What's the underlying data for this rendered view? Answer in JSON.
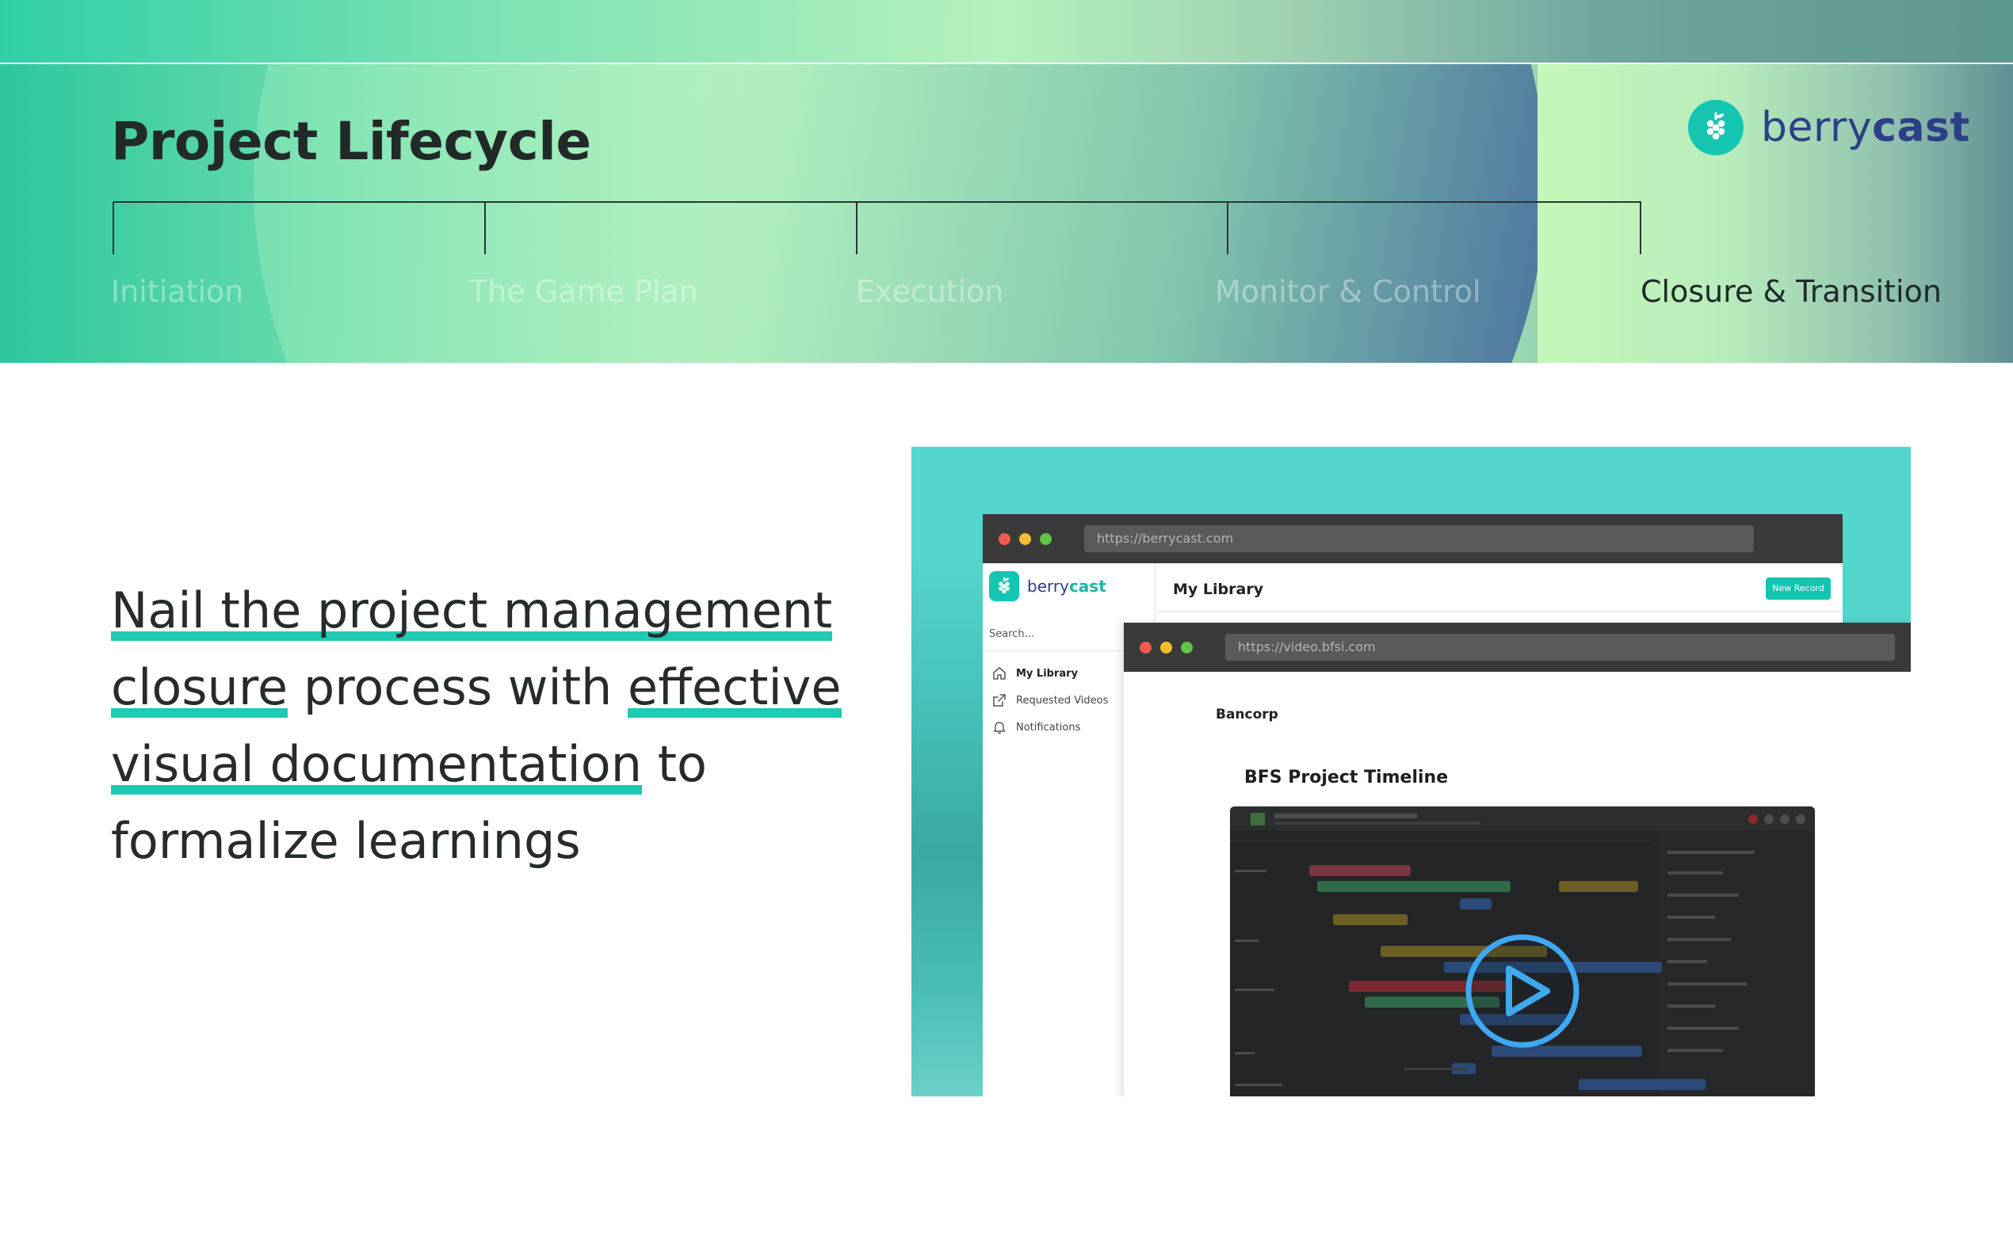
{
  "header": {
    "title": "Project Lifecycle",
    "phases": [
      {
        "label": "Initiation",
        "active": false
      },
      {
        "label": "The Game Plan",
        "active": false
      },
      {
        "label": "Execution",
        "active": false
      },
      {
        "label": "Monitor & Control",
        "active": false
      },
      {
        "label": "Closure & Transition",
        "active": true
      }
    ]
  },
  "brand": {
    "logo_prefix": "berry",
    "logo_suffix": "cast",
    "logo_icon": "grape-icon",
    "accent_color": "#14c5b2",
    "brand_navy": "#2d3f86"
  },
  "headline": {
    "parts": [
      {
        "text": "Nail the project management",
        "highlighted": true
      },
      {
        "text": "closure",
        "highlighted": true
      },
      {
        "text": " process with ",
        "highlighted": false
      },
      {
        "text": "effective",
        "highlighted": true
      },
      {
        "text": "visual documentation",
        "highlighted": true
      },
      {
        "text": " to",
        "highlighted": false
      },
      {
        "text": "formalize learnings",
        "highlighted": false
      }
    ],
    "highlight_color": "#1fc9b2"
  },
  "app_window": {
    "url": "https://berrycast.com",
    "logo_prefix": "berry",
    "logo_suffix": "cast",
    "search_placeholder": "Search...",
    "nav": [
      {
        "label": "My Library",
        "icon": "home-icon",
        "active": true
      },
      {
        "label": "Requested Videos",
        "icon": "external-link-icon",
        "active": false
      },
      {
        "label": "Notifications",
        "icon": "bell-icon",
        "active": false
      }
    ],
    "page_title": "My Library",
    "new_record_label": "New Record"
  },
  "video_window": {
    "url": "https://video.bfsi.com",
    "company": "Bancorp",
    "title": "BFS Project Timeline",
    "play_icon": "play-icon"
  }
}
